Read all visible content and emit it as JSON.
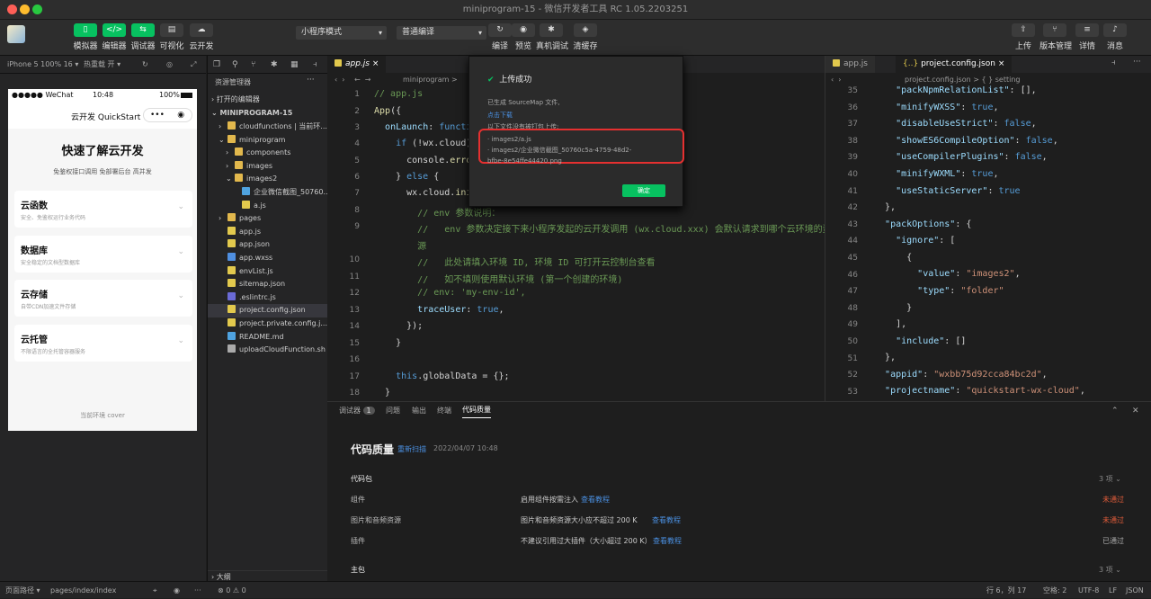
{
  "window": {
    "title": "miniprogram-15 - 微信开发者工具 RC 1.05.2203251"
  },
  "toolbar": {
    "left_buttons": [
      "模拟器",
      "编辑器",
      "调试器",
      "可视化",
      "云开发"
    ],
    "mode_select": "小程序模式",
    "compile_select": "普通编译",
    "mid_buttons": [
      "编译",
      "预览",
      "真机调试",
      "清缓存"
    ],
    "right_buttons": [
      "上传",
      "版本管理",
      "详情",
      "消息"
    ]
  },
  "simulator": {
    "device": "iPhone 5 100% 16 ▾",
    "hot_reload": "热重载 开 ▾",
    "status_carrier": "●●●●● WeChat",
    "status_time": "10:48",
    "status_battery": "100%",
    "nav_title": "云开发 QuickStart",
    "heading": "快速了解云开发",
    "subheading": "免鉴权接口调用 免部署后台 高并发",
    "cards": [
      {
        "title": "云函数",
        "desc": "安全、免鉴权运行业务代码"
      },
      {
        "title": "数据库",
        "desc": "安全稳定的文档型数据库"
      },
      {
        "title": "云存储",
        "desc": "自带CDN加速文件存储"
      },
      {
        "title": "云托管",
        "desc": "不限语言的全托管容器服务"
      }
    ],
    "footer": "当前环境 cover"
  },
  "explorer": {
    "title": "资源管理器",
    "open_editors": "打开的编辑器",
    "root": "MINIPROGRAM-15",
    "items": [
      {
        "label": "cloudfunctions | 当前环...",
        "color": "#e2b84d"
      },
      {
        "label": "miniprogram",
        "color": "#e2b84d"
      },
      {
        "label": "components",
        "color": "#e2b84d"
      },
      {
        "label": "images",
        "color": "#e2b84d"
      },
      {
        "label": "images2",
        "color": "#e2b84d"
      },
      {
        "label": "企业微信截图_50760...",
        "color": "#4fa3e0"
      },
      {
        "label": "a.js",
        "color": "#e2c94d"
      },
      {
        "label": "pages",
        "color": "#e2b84d"
      },
      {
        "label": "app.js",
        "color": "#e2c94d"
      },
      {
        "label": "app.json",
        "color": "#e2c94d"
      },
      {
        "label": "app.wxss",
        "color": "#4f8fe0"
      },
      {
        "label": "envList.js",
        "color": "#e2c94d"
      },
      {
        "label": "sitemap.json",
        "color": "#e2c94d"
      },
      {
        "label": ".eslintrc.js",
        "color": "#6b6bd6"
      },
      {
        "label": "project.config.json",
        "color": "#e2c94d"
      },
      {
        "label": "project.private.config.j...",
        "color": "#e2c94d"
      },
      {
        "label": "README.md",
        "color": "#4fa3e0"
      },
      {
        "label": "uploadCloudFunction.sh",
        "color": "#aaaaaa"
      }
    ],
    "outline": "大纲"
  },
  "editor_left": {
    "tab": "app.js",
    "breadcrumb": "miniprogram >",
    "line_numbers": [
      "1",
      "2",
      "3",
      "4",
      "5",
      "6",
      "7",
      "8",
      "9",
      "",
      "10",
      "11",
      "12",
      "13",
      "14",
      "15",
      "16",
      "17",
      "18"
    ]
  },
  "popup": {
    "title": "上传成功",
    "line1": "已生成 SourceMap 文件,",
    "link": "点击下载",
    "line2": "以下文件没有被打包上传:",
    "files": [
      "· images2/a.js",
      "· images2/企业微信截图_50760c5a-4759-48d2-",
      "bfbe-8e54ffe44420.png"
    ],
    "confirm": "确定"
  },
  "editor_right": {
    "tabs": [
      "app.js",
      "project.config.json"
    ],
    "breadcrumb": "project.config.json > { } setting",
    "line_numbers": [
      "35",
      "36",
      "37",
      "38",
      "39",
      "40",
      "41",
      "42",
      "43",
      "44",
      "45",
      "46",
      "47",
      "48",
      "49",
      "50",
      "51",
      "52",
      "53"
    ]
  },
  "bottom": {
    "tabs": [
      "调试器",
      "问题",
      "输出",
      "终端",
      "代码质量"
    ],
    "badge": "1",
    "title": "代码质量",
    "rescan": "重新扫描",
    "date": "2022/04/07 10:48",
    "section1": "代码包",
    "section1_count": "3 项 ⌄",
    "rows": [
      {
        "name": "组件",
        "desc": "启用组件按需注入",
        "link": "查看教程",
        "status": "未通过",
        "color": "#e05c3a"
      },
      {
        "name": "图片和音频资源",
        "desc": "图片和音频资源大小应不超过 200 K",
        "link": "查看教程",
        "status": "未通过",
        "color": "#e05c3a"
      },
      {
        "name": "插件",
        "desc": "不建议引用过大插件（大小超过 200 K）",
        "link": "查看教程",
        "status": "已通过",
        "color": "#aaaaaa"
      }
    ],
    "section2": "主包",
    "section2_count": "3 项 ⌄"
  },
  "status": {
    "path_label": "页面路径 ▾",
    "path": "pages/index/index",
    "errors": "⊗ 0 ⚠ 0",
    "cursor": "行 6，列 17",
    "spaces": "空格: 2",
    "encoding": "UTF-8",
    "eol": "LF",
    "lang": "JSON"
  }
}
